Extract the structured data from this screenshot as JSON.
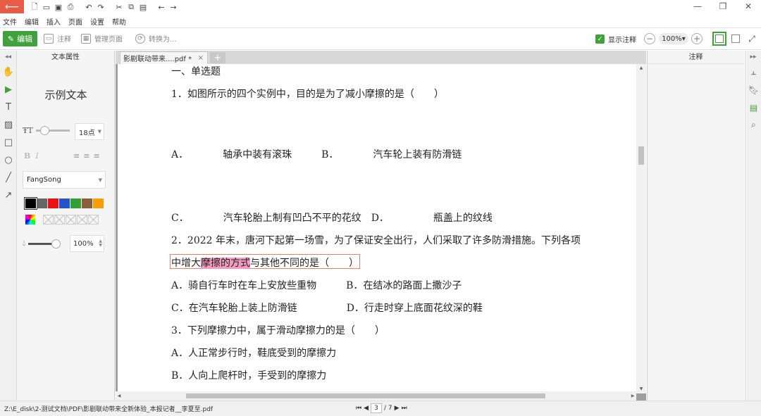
{
  "titlebar": {
    "back_icon": "arrow-left-icon",
    "menu": [
      "文件",
      "编辑",
      "插入",
      "页面",
      "设置",
      "帮助"
    ],
    "accent": "#e95a47"
  },
  "toolbar": {
    "edit_label": "编辑",
    "annotate_label": "注释",
    "manage_pages_label": "管理页面",
    "convert_label": "转换为...",
    "show_annotations_label": "显示注释",
    "show_annotations_checked": true,
    "zoom": "100%",
    "accent": "#3fa23c"
  },
  "props_panel": {
    "title": "文本属性",
    "sample_text": "示例文本",
    "font_size": "18点",
    "font_name": "FangSong",
    "opacity": "100%",
    "colors": [
      "#000000",
      "#666666",
      "#ee1111",
      "#2255cc",
      "#33a033",
      "#8b5e3c",
      "#f5a000"
    ]
  },
  "tab": {
    "title": "影剧联动带来....pdf *",
    "close": "×",
    "add": "+"
  },
  "document": {
    "section": "一、单选题",
    "q1": "1．如图所示的四个实例中，目的是为了减小摩擦的是（　　）",
    "q1_ab": "A．　　　　轴承中装有滚珠　　　B．　　　　汽车轮上装有防滑链",
    "q1_cd": "C．　　　　汽车轮胎上制有凹凸不平的花纹　D．　　　　　瓶盖上的纹线",
    "q2_line1": "2．2022 年末，唐河下起第一场雪，为了保证安全出行，人们采取了许多防滑措施。下列各项",
    "q2_line2_pre": "中增大",
    "q2_line2_hl": "摩擦的方式",
    "q2_line2_post": "与其他不同的是（　　）",
    "q2_ab": "A．骑自行车时在车上安放些重物　　　B．在结冰的路面上撒沙子",
    "q2_cd": "C．在汽车轮胎上装上防滑链　　　　　D．行走时穿上底面花纹深的鞋",
    "q3": "3．下列摩擦力中，属于滑动摩擦力的是（　　）",
    "q3_a": "A．人正常步行时，鞋底受到的摩擦力",
    "q3_b": "B．人向上爬杆时，手受到的摩擦力"
  },
  "anno_panel": {
    "title": "注释"
  },
  "status": {
    "path": "Z:\\E_disk\\2-测试文档\\PDF\\影剧联动带来全新体验_本报记者__李夏至.pdf",
    "page": "3",
    "total": "/ 7"
  }
}
